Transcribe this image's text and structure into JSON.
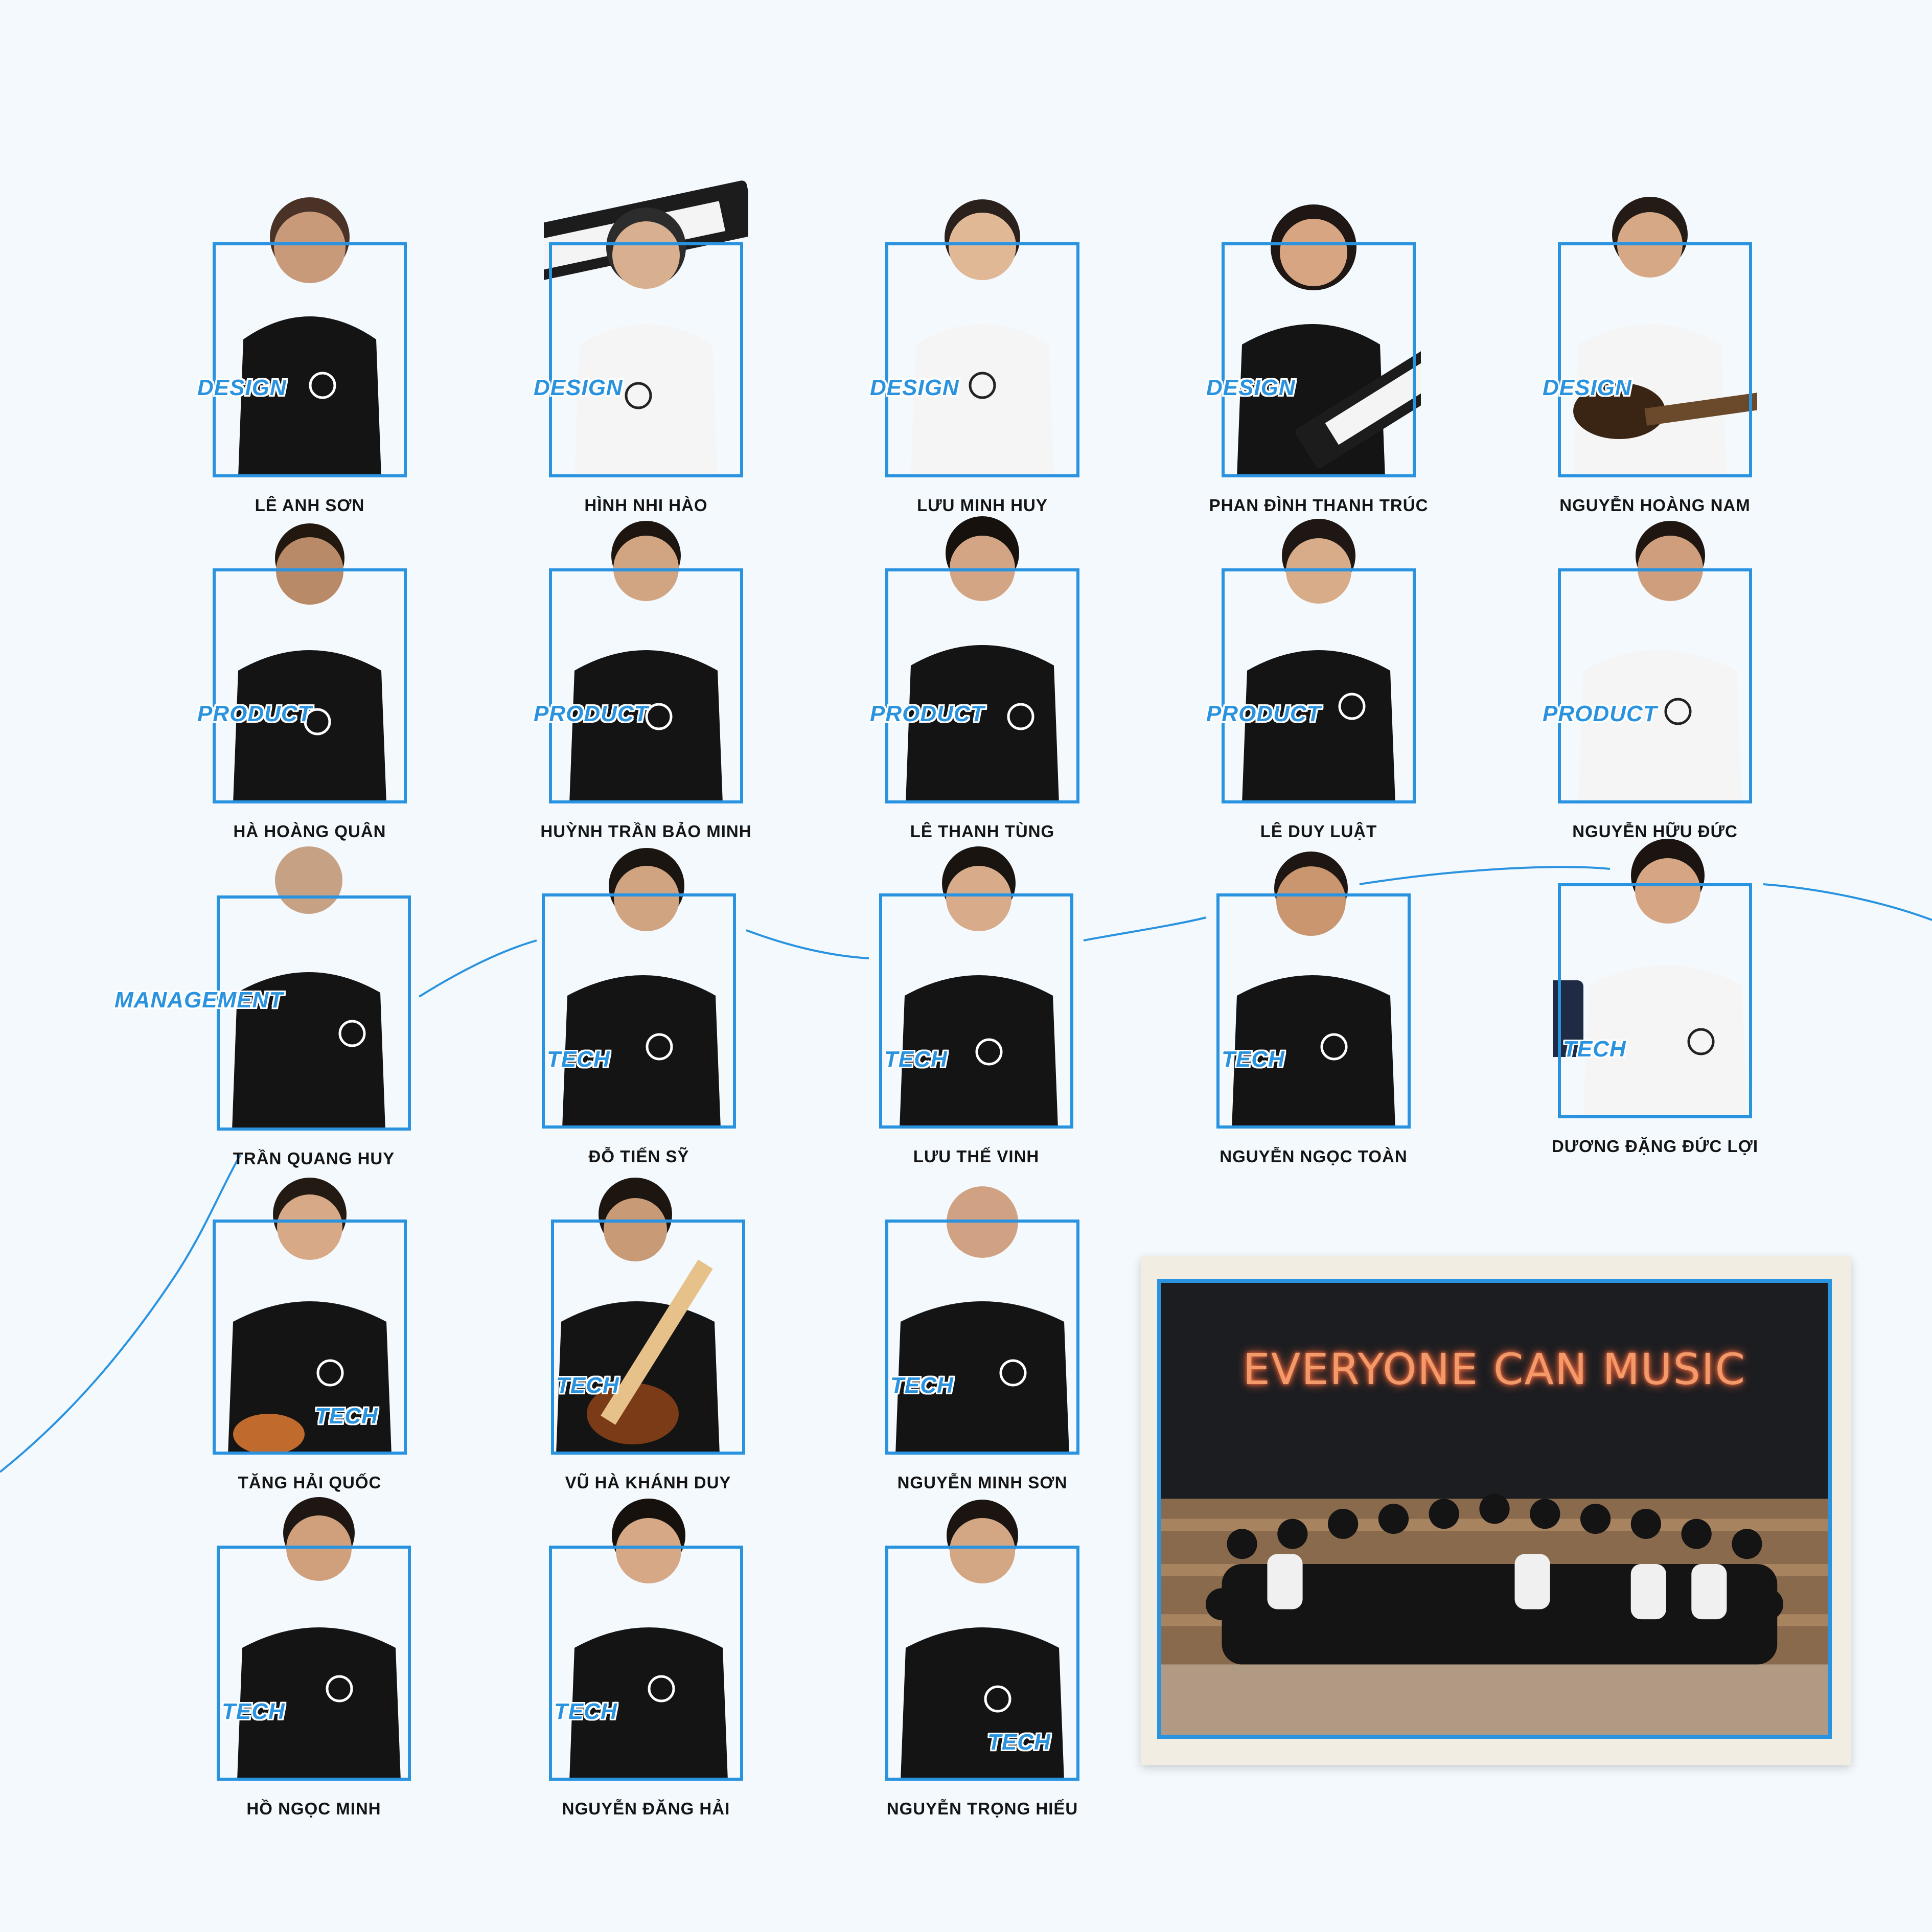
{
  "colors": {
    "accent": "#2a93e0",
    "background": "#f3f9fd",
    "name_text": "#141414"
  },
  "members": [
    {
      "name": "LÊ ANH SƠN",
      "team": "DESIGN"
    },
    {
      "name": "HÌNH NHI HÀO",
      "team": "DESIGN"
    },
    {
      "name": "LƯU MINH HUY",
      "team": "DESIGN"
    },
    {
      "name": "PHAN ĐÌNH THANH TRÚC",
      "team": "DESIGN"
    },
    {
      "name": "NGUYỄN HOÀNG NAM",
      "team": "DESIGN"
    },
    {
      "name": "HÀ HOÀNG QUÂN",
      "team": "PRODUCT"
    },
    {
      "name": "HUỲNH TRẦN BẢO MINH",
      "team": "PRODUCT"
    },
    {
      "name": "LÊ THANH TÙNG",
      "team": "PRODUCT"
    },
    {
      "name": "LÊ DUY LUẬT",
      "team": "PRODUCT"
    },
    {
      "name": "NGUYỄN HỮU ĐỨC",
      "team": "PRODUCT"
    },
    {
      "name": "TRẦN QUANG HUY",
      "team": "MANAGEMENT"
    },
    {
      "name": "ĐỖ TIẾN SỸ",
      "team": "TECH"
    },
    {
      "name": "LƯU THẾ VINH",
      "team": "TECH"
    },
    {
      "name": "NGUYỄN NGỌC TOÀN",
      "team": "TECH"
    },
    {
      "name": "DƯƠNG ĐẶNG ĐỨC LỢI",
      "team": "TECH"
    },
    {
      "name": "TĂNG HẢI QUỐC",
      "team": "TECH"
    },
    {
      "name": "VŨ HÀ KHÁNH DUY",
      "team": "TECH"
    },
    {
      "name": "NGUYỄN MINH SƠN",
      "team": "TECH"
    },
    {
      "name": "HỒ NGỌC MINH",
      "team": "TECH"
    },
    {
      "name": "NGUYỄN ĐĂNG HẢI",
      "team": "TECH"
    },
    {
      "name": "NGUYỄN TRỌNG HIẾU",
      "team": "TECH"
    }
  ],
  "group_photo": {
    "sign_text": "EVERYONE CAN MUSIC"
  }
}
